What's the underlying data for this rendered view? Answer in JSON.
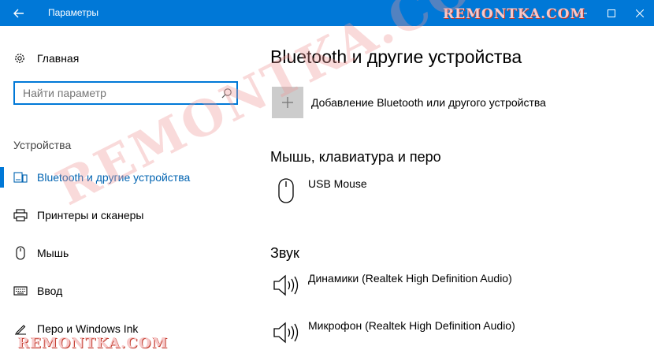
{
  "window": {
    "title": "Параметры",
    "watermark": "REMONTKA.COM"
  },
  "sidebar": {
    "home_label": "Главная",
    "search_placeholder": "Найти параметр",
    "section_label": "Устройства",
    "items": [
      {
        "label": "Bluetooth и другие устройства",
        "icon": "bluetooth-devices-icon",
        "active": true
      },
      {
        "label": "Принтеры и сканеры",
        "icon": "printer-icon",
        "active": false
      },
      {
        "label": "Мышь",
        "icon": "mouse-icon",
        "active": false
      },
      {
        "label": "Ввод",
        "icon": "keyboard-icon",
        "active": false
      },
      {
        "label": "Перо и Windows Ink",
        "icon": "pen-icon",
        "active": false
      }
    ]
  },
  "main": {
    "title": "Bluetooth и другие устройства",
    "add_label": "Добавление Bluetooth или другого устройства",
    "groups": [
      {
        "title": "Мышь, клавиатура и перо",
        "devices": [
          {
            "name": "USB Mouse",
            "icon": "mouse-icon"
          }
        ]
      },
      {
        "title": "Звук",
        "devices": [
          {
            "name": "Динамики (Realtek High Definition Audio)",
            "icon": "speaker-icon"
          },
          {
            "name": "Микрофон (Realtek High Definition Audio)",
            "icon": "speaker-icon"
          }
        ]
      }
    ]
  },
  "colors": {
    "accent": "#0078d7",
    "add_tile": "#cccccc",
    "watermark": "#c0392b"
  }
}
